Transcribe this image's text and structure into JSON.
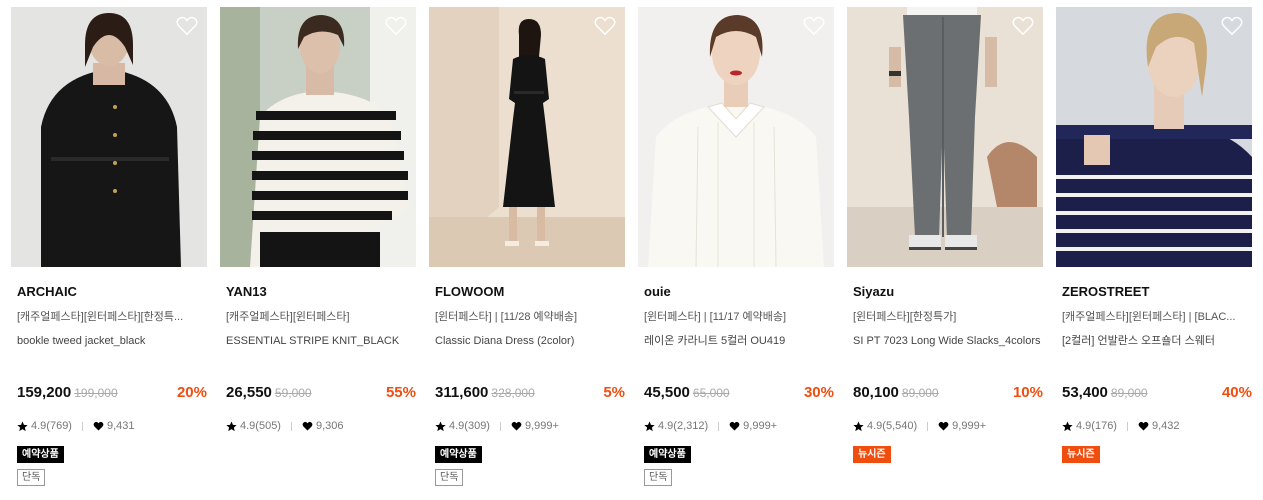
{
  "products": [
    {
      "brand": "ARCHAIC",
      "tags": "[캐주얼페스타][윈터페스타][한정특...",
      "name": "bookle tweed jacket_black",
      "price": "159,200",
      "original_price": "199,000",
      "discount": "20%",
      "rating": "4.9(769)",
      "likes": "9,431",
      "badge": "예약상품",
      "badge_color": "#000000",
      "exclusive": "단독",
      "icon": "heart-outline-icon"
    },
    {
      "brand": "YAN13",
      "tags": "[캐주얼페스타][윈터페스타]",
      "name": "ESSENTIAL STRIPE KNIT_BLACK",
      "price": "26,550",
      "original_price": "59,000",
      "discount": "55%",
      "rating": "4.9(505)",
      "likes": "9,306",
      "badge": "",
      "exclusive": "",
      "icon": "heart-outline-icon"
    },
    {
      "brand": "FLOWOOM",
      "tags": "[윈터페스타] | [11/28 예약배송]",
      "name": "Classic Diana Dress (2color)",
      "price": "311,600",
      "original_price": "328,000",
      "discount": "5%",
      "rating": "4.9(309)",
      "likes": "9,999+",
      "badge": "예약상품",
      "badge_color": "#000000",
      "exclusive": "단독",
      "icon": "heart-outline-icon"
    },
    {
      "brand": "ouie",
      "tags": "[윈터페스타] | [11/17 예약배송]",
      "name": "레이온 카라니트 5컬러 OU419",
      "price": "45,500",
      "original_price": "65,000",
      "discount": "30%",
      "rating": "4.9(2,312)",
      "likes": "9,999+",
      "badge": "예약상품",
      "badge_color": "#000000",
      "exclusive": "단독",
      "icon": "heart-outline-icon"
    },
    {
      "brand": "Siyazu",
      "tags": "[윈터페스타][한정특가]",
      "name": "SI PT 7023 Long Wide Slacks_4colors",
      "price": "80,100",
      "original_price": "89,000",
      "discount": "10%",
      "rating": "4.9(5,540)",
      "likes": "9,999+",
      "badge": "뉴시즌",
      "badge_color": "#f04d0f",
      "exclusive": "",
      "icon": "heart-outline-icon"
    },
    {
      "brand": "ZEROSTREET",
      "tags": "[캐주얼페스타][윈터페스타] | [BLAC...",
      "name": "[2컬러] 언발란스 오프숄더 스웨터",
      "price": "53,400",
      "original_price": "89,000",
      "discount": "40%",
      "rating": "4.9(176)",
      "likes": "9,432",
      "badge": "뉴시즌",
      "badge_color": "#f04d0f",
      "exclusive": "",
      "icon": "heart-outline-icon"
    }
  ],
  "colors": {
    "discount": "#f04d0f",
    "badge_black": "#000000",
    "badge_orange": "#f04d0f"
  }
}
